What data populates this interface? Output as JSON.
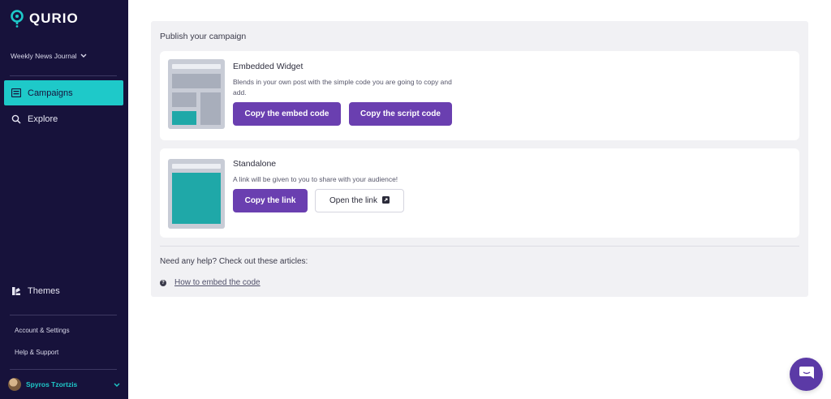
{
  "brand": {
    "name": "QURIO",
    "accent": "#1ec9c9",
    "sidebar_bg": "#17123b",
    "primary": "#6a3fb0"
  },
  "sidebar": {
    "workspace": "Weekly News Journal",
    "nav": [
      {
        "label": "Campaigns",
        "icon": "campaigns-icon",
        "active": true
      },
      {
        "label": "Explore",
        "icon": "search-icon",
        "active": false
      }
    ],
    "themes_label": "Themes",
    "account_label": "Account & Settings",
    "help_label": "Help & Support",
    "user_name": "Spyros Tzortzis"
  },
  "main": {
    "title": "Publish your campaign",
    "embedded": {
      "title": "Embedded Widget",
      "description": "Blends in your own post with the simple code you are going to copy and add.",
      "btn_embed": "Copy the embed code",
      "btn_script": "Copy the script code"
    },
    "standalone": {
      "title": "Standalone",
      "description": "A link will be given to you to share with your audience!",
      "btn_copy": "Copy the link",
      "btn_open": "Open the link"
    },
    "help": {
      "title": "Need any help? Check out these articles:",
      "link": "How to embed the code"
    }
  }
}
